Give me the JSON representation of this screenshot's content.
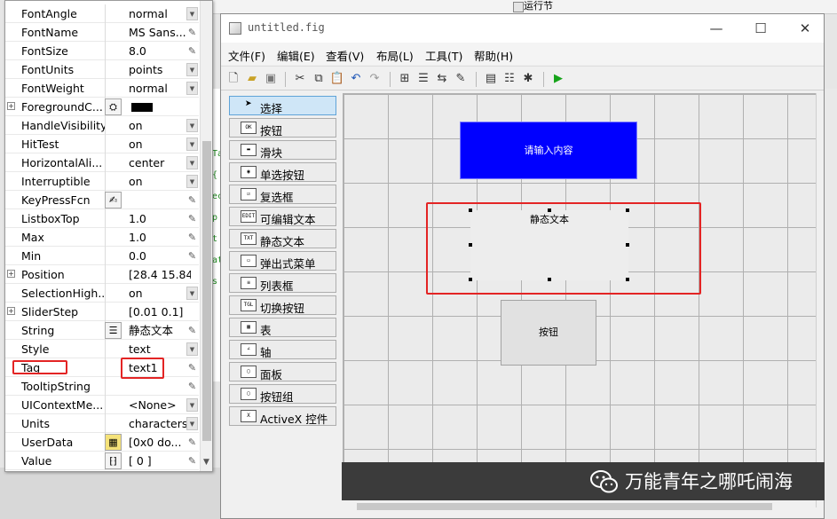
{
  "background": {
    "run_label": "运行节",
    "code_glyphs": [
      "Ta",
      "{",
      "ec",
      "p",
      "t",
      "at",
      "s"
    ]
  },
  "inspector": {
    "rows": [
      {
        "name": "FontAngle",
        "value": "normal",
        "control": "dropdown",
        "expandable": false
      },
      {
        "name": "FontName",
        "value": "MS Sans...",
        "control": "pencil",
        "expandable": false
      },
      {
        "name": "FontSize",
        "value": "8.0",
        "control": "pencil",
        "expandable": false
      },
      {
        "name": "FontUnits",
        "value": "points",
        "control": "dropdown",
        "expandable": false
      },
      {
        "name": "FontWeight",
        "value": "normal",
        "control": "dropdown",
        "expandable": false
      },
      {
        "name": "ForegroundC...",
        "value": "",
        "control": "none",
        "expandable": true,
        "color": "#000000"
      },
      {
        "name": "HandleVisibility",
        "value": "on",
        "control": "dropdown",
        "expandable": false
      },
      {
        "name": "HitTest",
        "value": "on",
        "control": "dropdown",
        "expandable": false
      },
      {
        "name": "HorizontalAli...",
        "value": "center",
        "control": "dropdown",
        "expandable": false
      },
      {
        "name": "Interruptible",
        "value": "on",
        "control": "dropdown",
        "expandable": false
      },
      {
        "name": "KeyPressFcn",
        "value": "",
        "control": "pencil",
        "expandable": false
      },
      {
        "name": "ListboxTop",
        "value": "1.0",
        "control": "pencil",
        "expandable": false
      },
      {
        "name": "Max",
        "value": "1.0",
        "control": "pencil",
        "expandable": false
      },
      {
        "name": "Min",
        "value": "0.0",
        "control": "pencil",
        "expandable": false
      },
      {
        "name": "Position",
        "value": "[28.4 15.84...",
        "control": "none",
        "expandable": true
      },
      {
        "name": "SelectionHigh...",
        "value": "on",
        "control": "dropdown",
        "expandable": false
      },
      {
        "name": "SliderStep",
        "value": "[0.01 0.1]",
        "control": "none",
        "expandable": true
      },
      {
        "name": "String",
        "value": "静态文本",
        "control": "pencil",
        "expandable": false
      },
      {
        "name": "Style",
        "value": "text",
        "control": "dropdown",
        "expandable": false
      },
      {
        "name": "Tag",
        "value": "text1",
        "control": "pencil",
        "expandable": false
      },
      {
        "name": "TooltipString",
        "value": "",
        "control": "pencil",
        "expandable": false
      },
      {
        "name": "UIContextMe...",
        "value": "<None>",
        "control": "dropdown",
        "expandable": false
      },
      {
        "name": "Units",
        "value": "characters",
        "control": "dropdown",
        "expandable": false
      },
      {
        "name": "UserData",
        "value": "[0x0  do...",
        "control": "pencil",
        "expandable": false
      },
      {
        "name": "Value",
        "value": "[ 0 ]",
        "control": "pencil",
        "expandable": false
      }
    ]
  },
  "guide": {
    "title": "untitled.fig",
    "window_controls": {
      "minimize": "—",
      "maximize": "☐",
      "close": "✕"
    },
    "menu": [
      "文件(F)",
      "编辑(E)",
      "查看(V)",
      "布局(L)",
      "工具(T)",
      "帮助(H)"
    ],
    "palette": [
      {
        "label": "选择",
        "icon": "OK",
        "selected": true
      },
      {
        "label": "按钮",
        "icon": "OK",
        "selected": false
      },
      {
        "label": "滑块",
        "icon": "▬",
        "selected": false
      },
      {
        "label": "单选按钮",
        "icon": "◉",
        "selected": false
      },
      {
        "label": "复选框",
        "icon": "☑",
        "selected": false
      },
      {
        "label": "可编辑文本",
        "icon": "EDIT",
        "selected": false
      },
      {
        "label": "静态文本",
        "icon": "TXT",
        "selected": false
      },
      {
        "label": "弹出式菜单",
        "icon": "▭",
        "selected": false
      },
      {
        "label": "列表框",
        "icon": "≡",
        "selected": false
      },
      {
        "label": "切换按钮",
        "icon": "TGL",
        "selected": false
      },
      {
        "label": "表",
        "icon": "▦",
        "selected": false
      },
      {
        "label": "轴",
        "icon": "∠",
        "selected": false
      },
      {
        "label": "面板",
        "icon": "▢",
        "selected": false
      },
      {
        "label": "按钮组",
        "icon": "▢",
        "selected": false
      },
      {
        "label": "ActiveX 控件",
        "icon": "X",
        "selected": false
      }
    ],
    "canvas": {
      "edit_text": "请输入内容",
      "edit_color": "#0000ff",
      "static_text": "静态文本",
      "push_button": "按钮"
    }
  },
  "watermark": {
    "text": "万能青年之哪吒闹海"
  }
}
